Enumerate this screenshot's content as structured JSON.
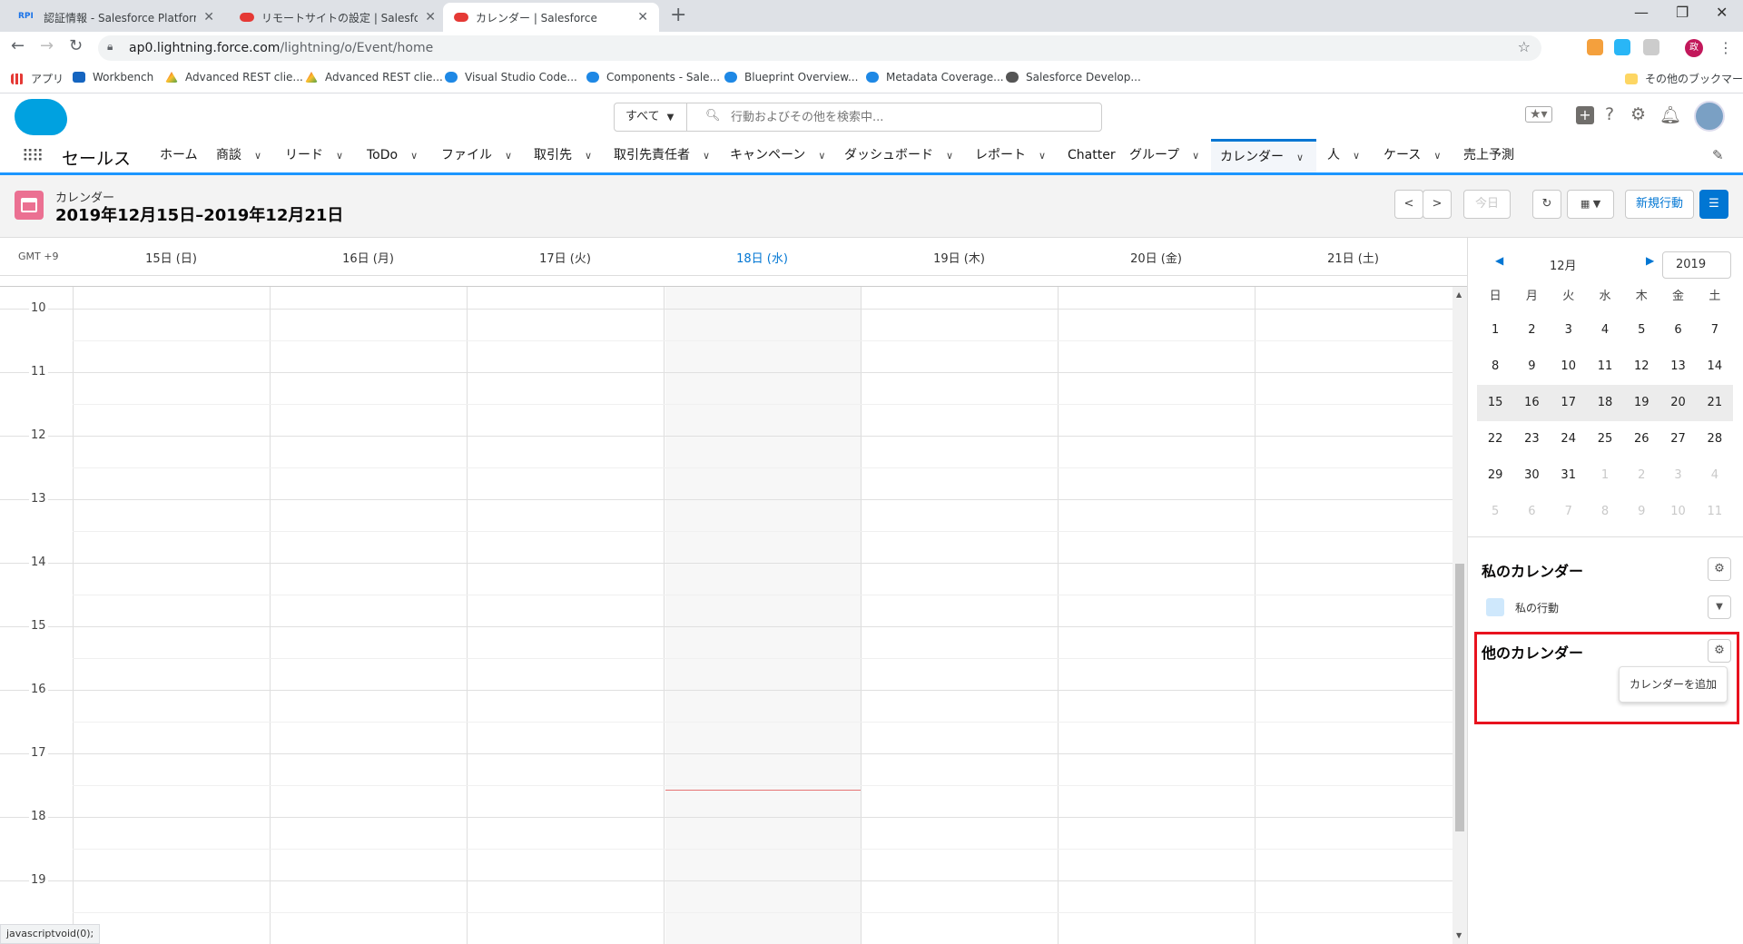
{
  "browser": {
    "tabs": [
      {
        "label": "認証情報 - Salesforce Platform A",
        "favicon": "rpi"
      },
      {
        "label": "リモートサイトの設定 | Salesforce",
        "favicon": "salesforce"
      },
      {
        "label": "カレンダー | Salesforce",
        "favicon": "salesforce",
        "active": true
      }
    ],
    "favicon_rpi_text": "RPI",
    "url_host": "ap0.lightning.force.com",
    "url_path": "/lightning/o/Event/home",
    "profile_initial": "政",
    "bookmarks": [
      {
        "label": "アプリ",
        "icon": "apps-icon"
      },
      {
        "label": "Workbench",
        "icon": "cube-icon"
      },
      {
        "label": "Advanced REST clie...",
        "icon": "rest-icon"
      },
      {
        "label": "Advanced REST clie...",
        "icon": "rest-icon"
      },
      {
        "label": "Visual Studio Code...",
        "icon": "cloud-icon"
      },
      {
        "label": "Components - Sale...",
        "icon": "cloud-icon"
      },
      {
        "label": "Blueprint Overview...",
        "icon": "cloud-icon"
      },
      {
        "label": "Metadata Coverage...",
        "icon": "cloud-icon"
      },
      {
        "label": "Salesforce Develop...",
        "icon": "globe-icon"
      }
    ],
    "other_bookmarks": "その他のブックマーク",
    "status_text": "javascriptvoid(0);"
  },
  "sf": {
    "search_scope": "すべて",
    "search_placeholder": "行動およびその他を検索中...",
    "app_name": "セールス",
    "nav": [
      {
        "label": "ホーム",
        "chevron": false
      },
      {
        "label": "商談",
        "chevron": true
      },
      {
        "label": "リード",
        "chevron": true
      },
      {
        "label": "ToDo",
        "chevron": true
      },
      {
        "label": "ファイル",
        "chevron": true
      },
      {
        "label": "取引先",
        "chevron": true
      },
      {
        "label": "取引先責任者",
        "chevron": true
      },
      {
        "label": "キャンペーン",
        "chevron": true
      },
      {
        "label": "ダッシュボード",
        "chevron": true
      },
      {
        "label": "レポート",
        "chevron": true
      },
      {
        "label": "Chatter",
        "chevron": false
      },
      {
        "label": "グループ",
        "chevron": true
      },
      {
        "label": "カレンダー",
        "chevron": true,
        "active": true
      },
      {
        "label": "人",
        "chevron": true
      },
      {
        "label": "ケース",
        "chevron": true
      },
      {
        "label": "売上予測",
        "chevron": false
      }
    ]
  },
  "calendar": {
    "object_label": "カレンダー",
    "date_range": "2019年12月15日–2019年12月21日",
    "today_button": "今日",
    "new_event_button": "新規行動",
    "timezone": "GMT +9",
    "days": [
      "15日 (日)",
      "16日 (月)",
      "17日 (火)",
      "18日 (水)",
      "19日 (木)",
      "20日 (金)",
      "21日 (土)"
    ],
    "today_index": 3,
    "hours": [
      "10",
      "11",
      "12",
      "13",
      "14",
      "15",
      "16",
      "17",
      "18",
      "19"
    ]
  },
  "mini_calendar": {
    "month": "12月",
    "year": "2019",
    "weekday_headers": [
      "日",
      "月",
      "火",
      "水",
      "木",
      "金",
      "土"
    ],
    "weeks": [
      [
        "1",
        "2",
        "3",
        "4",
        "5",
        "6",
        "7"
      ],
      [
        "8",
        "9",
        "10",
        "11",
        "12",
        "13",
        "14"
      ],
      [
        "15",
        "16",
        "17",
        "18",
        "19",
        "20",
        "21"
      ],
      [
        "22",
        "23",
        "24",
        "25",
        "26",
        "27",
        "28"
      ],
      [
        "29",
        "30",
        "31",
        "1",
        "2",
        "3",
        "4"
      ],
      [
        "5",
        "6",
        "7",
        "8",
        "9",
        "10",
        "11"
      ]
    ],
    "selected_week": 2
  },
  "sidebar": {
    "my_calendars_title": "私のカレンダー",
    "my_events_label": "私の行動",
    "my_events_color": "#cfe8fc",
    "other_calendars_title": "他のカレンダー",
    "add_calendar_label": "カレンダーを追加"
  },
  "colors": {
    "brand": "#0176d3",
    "calendar_icon": "#eb7092",
    "highlight_box": "#e8121e",
    "now_line": "#e57373"
  }
}
